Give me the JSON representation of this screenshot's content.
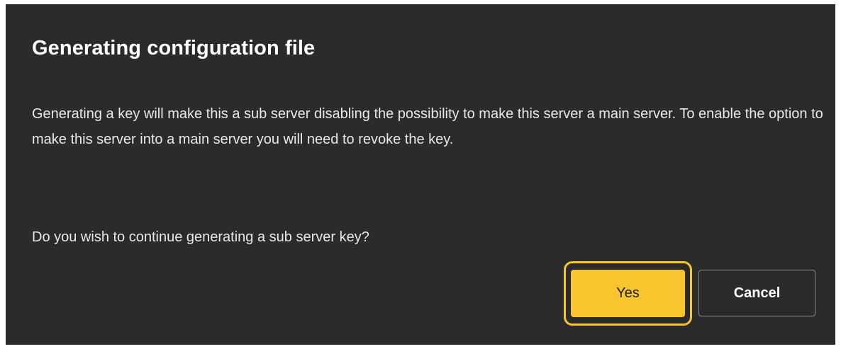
{
  "dialog": {
    "title": "Generating configuration file",
    "message": "Generating a key will make this a sub server disabling the possibility to make this server a main server. To enable the option to make this server into a main server you will need to revoke the key.",
    "question": "Do you wish to continue generating a sub server key?",
    "buttons": {
      "yes_label": "Yes",
      "cancel_label": "Cancel"
    }
  },
  "colors": {
    "background": "#2b2b2b",
    "accent": "#f9c52f",
    "text": "#ffffff",
    "cancel_border": "#8a8a8a"
  }
}
